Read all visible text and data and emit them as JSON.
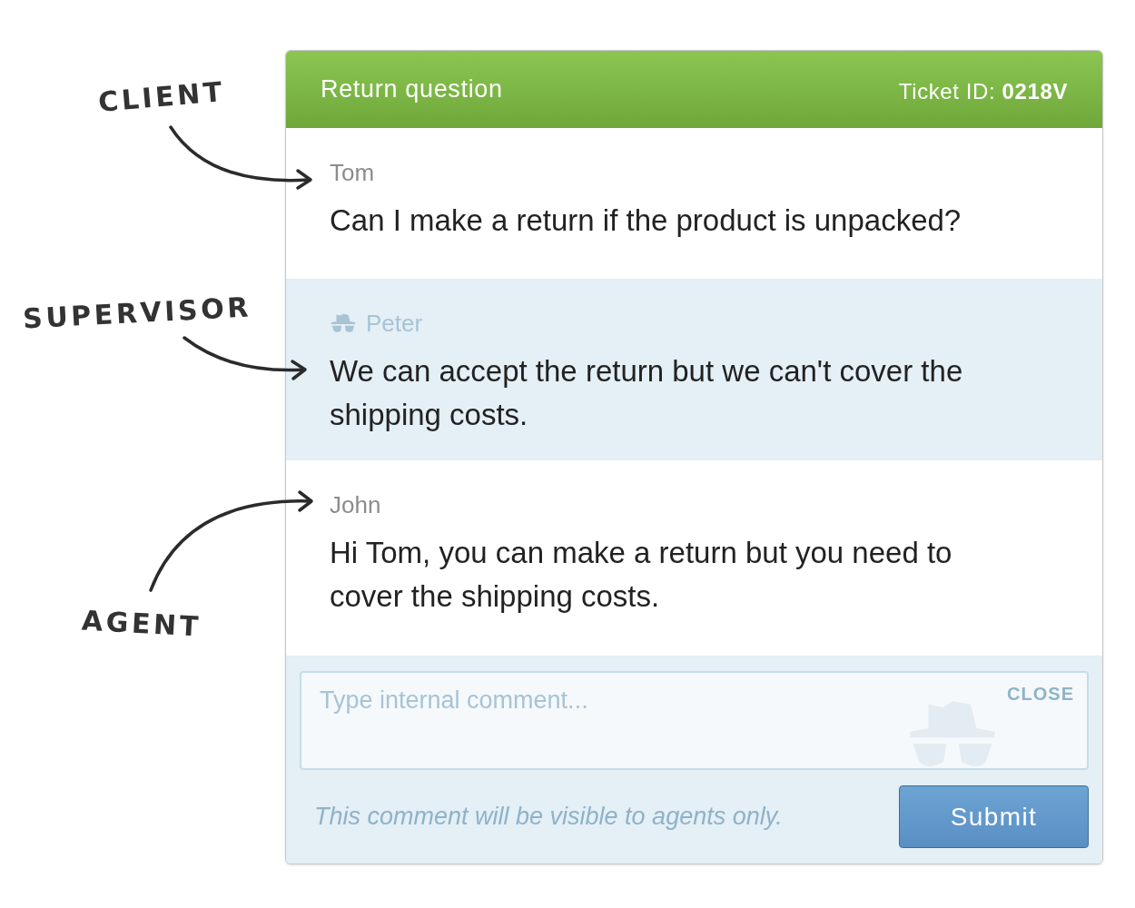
{
  "annotations": [
    {
      "label": "CLIENT"
    },
    {
      "label": "SUPERVISOR"
    },
    {
      "label": "AGENT"
    }
  ],
  "ticket": {
    "title": "Return question",
    "ticket_id": "Ticket ID: **0218V**"
  },
  "messages": [
    {
      "kind": "client",
      "author": "Tom",
      "text": "Can I make a return if the product is unpacked?"
    },
    {
      "kind": "supervisor",
      "author": "Peter",
      "text": "We can accept the return but we can't cover the shipping costs."
    },
    {
      "kind": "agent",
      "author": "John",
      "text": "Hi Tom, you can make a return but you need to cover the shipping costs."
    }
  ],
  "comment": {
    "placeholder": "Type internal comment...",
    "close": "CLOSE",
    "note": "This comment will be visible to agents only.",
    "submit": "Submit"
  }
}
